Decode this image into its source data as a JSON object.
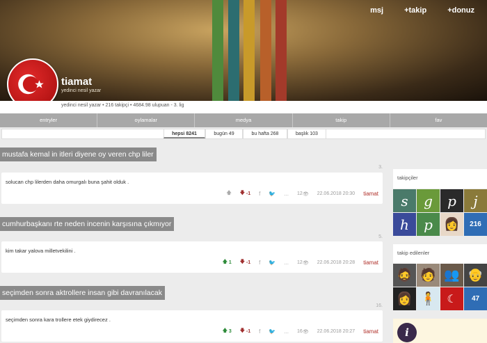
{
  "header": {
    "nav": [
      "msj",
      "+takip",
      "+donuz"
    ],
    "username": "tiamat",
    "rank": "yedinci nesil yazar",
    "stats_line": "yedinci nesil yazar • 216 takipçi • 4684.98 ulupuan - 3. lig"
  },
  "tabs": [
    "entryler",
    "oylamalar",
    "medya",
    "takip",
    "fav"
  ],
  "subtabs": [
    "hepsi 8241",
    "bugün 49",
    "bu hafta 268",
    "başlık 103"
  ],
  "entries": [
    {
      "title": "mustafa kemal in itleri diyene oy veren chp liler",
      "number": "3.",
      "text": "solucan chp lilerden daha omurgalı buna şahit olduk .",
      "up": "",
      "down": "-1",
      "more": "...",
      "views": "12",
      "datetime": "22.06.2018 20:30",
      "author": "tiamat"
    },
    {
      "title": "cumhurbaşkanı rte neden incenin karşısına çıkmıyor",
      "number": "5.",
      "text": "kim takar yalova milletvekilini .",
      "up": "1",
      "down": "-1",
      "more": "...",
      "views": "12",
      "datetime": "22.06.2018 20:28",
      "author": "tiamat"
    },
    {
      "title": "seçimden sonra aktrollere insan gibi davranılacak",
      "number": "16.",
      "text": "seçimden sonra kara trollere etek giydirecez .",
      "up": "3",
      "down": "-1",
      "more": "...",
      "views": "16",
      "datetime": "22.06.2018 20:27",
      "author": "tiamat"
    }
  ],
  "sidebar": {
    "followers_title": "takipçiler",
    "followers_letters": [
      "s",
      "g",
      "p",
      "j",
      "h",
      "p"
    ],
    "followers_count": "216",
    "following_title": "takip edilenler",
    "following_count": "47",
    "badge_letter": "i"
  },
  "colors": {
    "accent": "#b0302a",
    "tab_bg": "#a8a8a8",
    "title_bg": "#8a8a8a",
    "count_tile": "#2f6db5",
    "up": "#2e8b3a",
    "down": "#a03030"
  }
}
